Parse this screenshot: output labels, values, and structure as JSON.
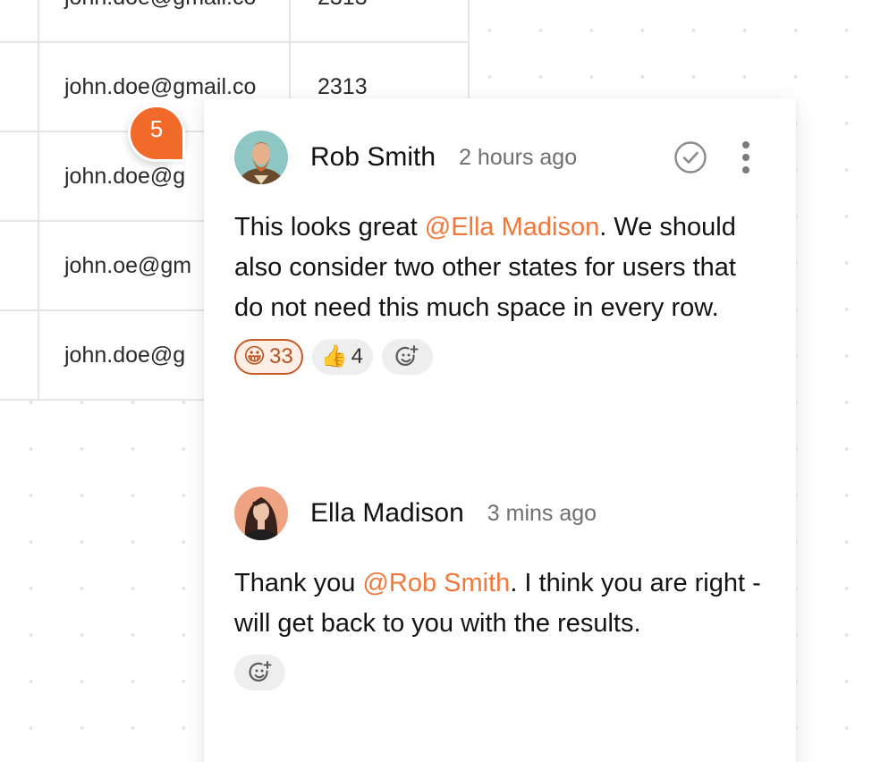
{
  "table": {
    "rows": [
      {
        "email": "john.doe@gmail.co",
        "number": "2313"
      },
      {
        "email": "john.doe@gmail.co",
        "number": "2313"
      },
      {
        "email": "john.doe@g",
        "number": ""
      },
      {
        "email": "john.oe@gm",
        "number": ""
      },
      {
        "email": "john.doe@g",
        "number": ""
      }
    ]
  },
  "marker": {
    "count": "5",
    "color": "#f26a2a"
  },
  "comments": [
    {
      "author": "Rob Smith",
      "time": "2 hours ago",
      "text_before": "This looks great ",
      "mention": "@Ella Madison",
      "text_after": ". We should also consider two other states for users that do not need this much space in every row.",
      "reactions": [
        {
          "emoji": "😀",
          "count": "33",
          "active": true
        },
        {
          "emoji": "👍",
          "count": "4",
          "active": false
        }
      ],
      "icons": {
        "resolve": "check-circle-icon",
        "more": "more-vertical-icon",
        "add_reaction": "add-emoji-icon"
      }
    },
    {
      "author": "Ella Madison",
      "time": "3 mins ago",
      "text_before": "Thank you ",
      "mention": "@Rob Smith",
      "text_after": ". I think you are right - will get back to you with the results.",
      "icons": {
        "add_reaction": "add-emoji-icon"
      }
    }
  ],
  "colors": {
    "accent": "#f1783a",
    "mention": "#f1783a"
  }
}
